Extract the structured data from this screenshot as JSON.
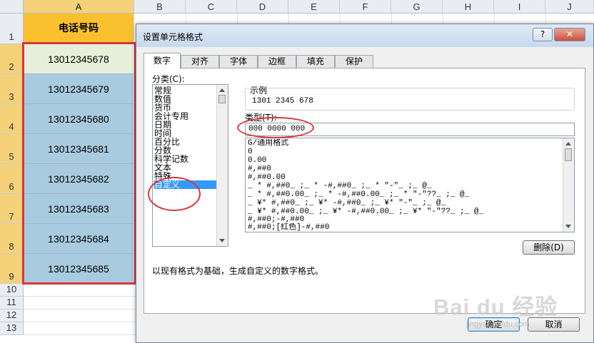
{
  "sheet": {
    "columns": [
      "A",
      "B",
      "C",
      "D",
      "E",
      "F",
      "G",
      "H",
      "I",
      "J"
    ],
    "rows": [
      "1",
      "2",
      "3",
      "4",
      "5",
      "6",
      "7",
      "8",
      "9",
      "10",
      "11",
      "12",
      "13"
    ],
    "header_cell": "电话号码",
    "values": [
      "13012345678",
      "13012345679",
      "13012345680",
      "13012345681",
      "13012345682",
      "13012345683",
      "13012345684",
      "13012345685"
    ]
  },
  "dialog": {
    "title": "设置单元格格式",
    "help": "?",
    "close": "✕",
    "tabs": [
      "数字",
      "对齐",
      "字体",
      "边框",
      "填充",
      "保护"
    ],
    "category_label": "分类(C):",
    "categories": [
      "常规",
      "数值",
      "货币",
      "会计专用",
      "日期",
      "时间",
      "百分比",
      "分数",
      "科学记数",
      "文本",
      "特殊",
      "自定义"
    ],
    "selected_category": "自定义",
    "sample_label": "示例",
    "sample_value": "1301 2345 678",
    "type_label": "类型(T):",
    "type_value": "000 0000 000",
    "formats": [
      "G/通用格式",
      "0",
      "0.00",
      "#,##0",
      "#,##0.00",
      "_ * #,##0_ ;_ * -#,##0_ ;_ * \"-\"_ ;_ @_",
      "_ * #,##0.00_ ;_ * -#,##0.00_ ;_ * \"-\"??_ ;_ @_",
      "_ ¥* #,##0_ ;_ ¥* -#,##0_ ;_ ¥* \"-\"_ ;_ @_",
      "_ ¥* #,##0.00_ ;_ ¥* -#,##0.00_ ;_ ¥* \"-\"??_ ;_ @_",
      "#,##0;-#,##0",
      "#,##0;[红色]-#,##0"
    ],
    "delete_button": "删除(D)",
    "description": "以现有格式为基础，生成自定义的数字格式。",
    "ok_button": "确定",
    "cancel_button": "取消"
  },
  "watermark": {
    "logo": "Bai du 经验",
    "url": "jingyan.baidu.com"
  },
  "colors": {
    "header_fill": "#fbc02d",
    "data_fill": "#a9cbe0",
    "highlight": "#d8353a",
    "selection": "#3399ff"
  }
}
